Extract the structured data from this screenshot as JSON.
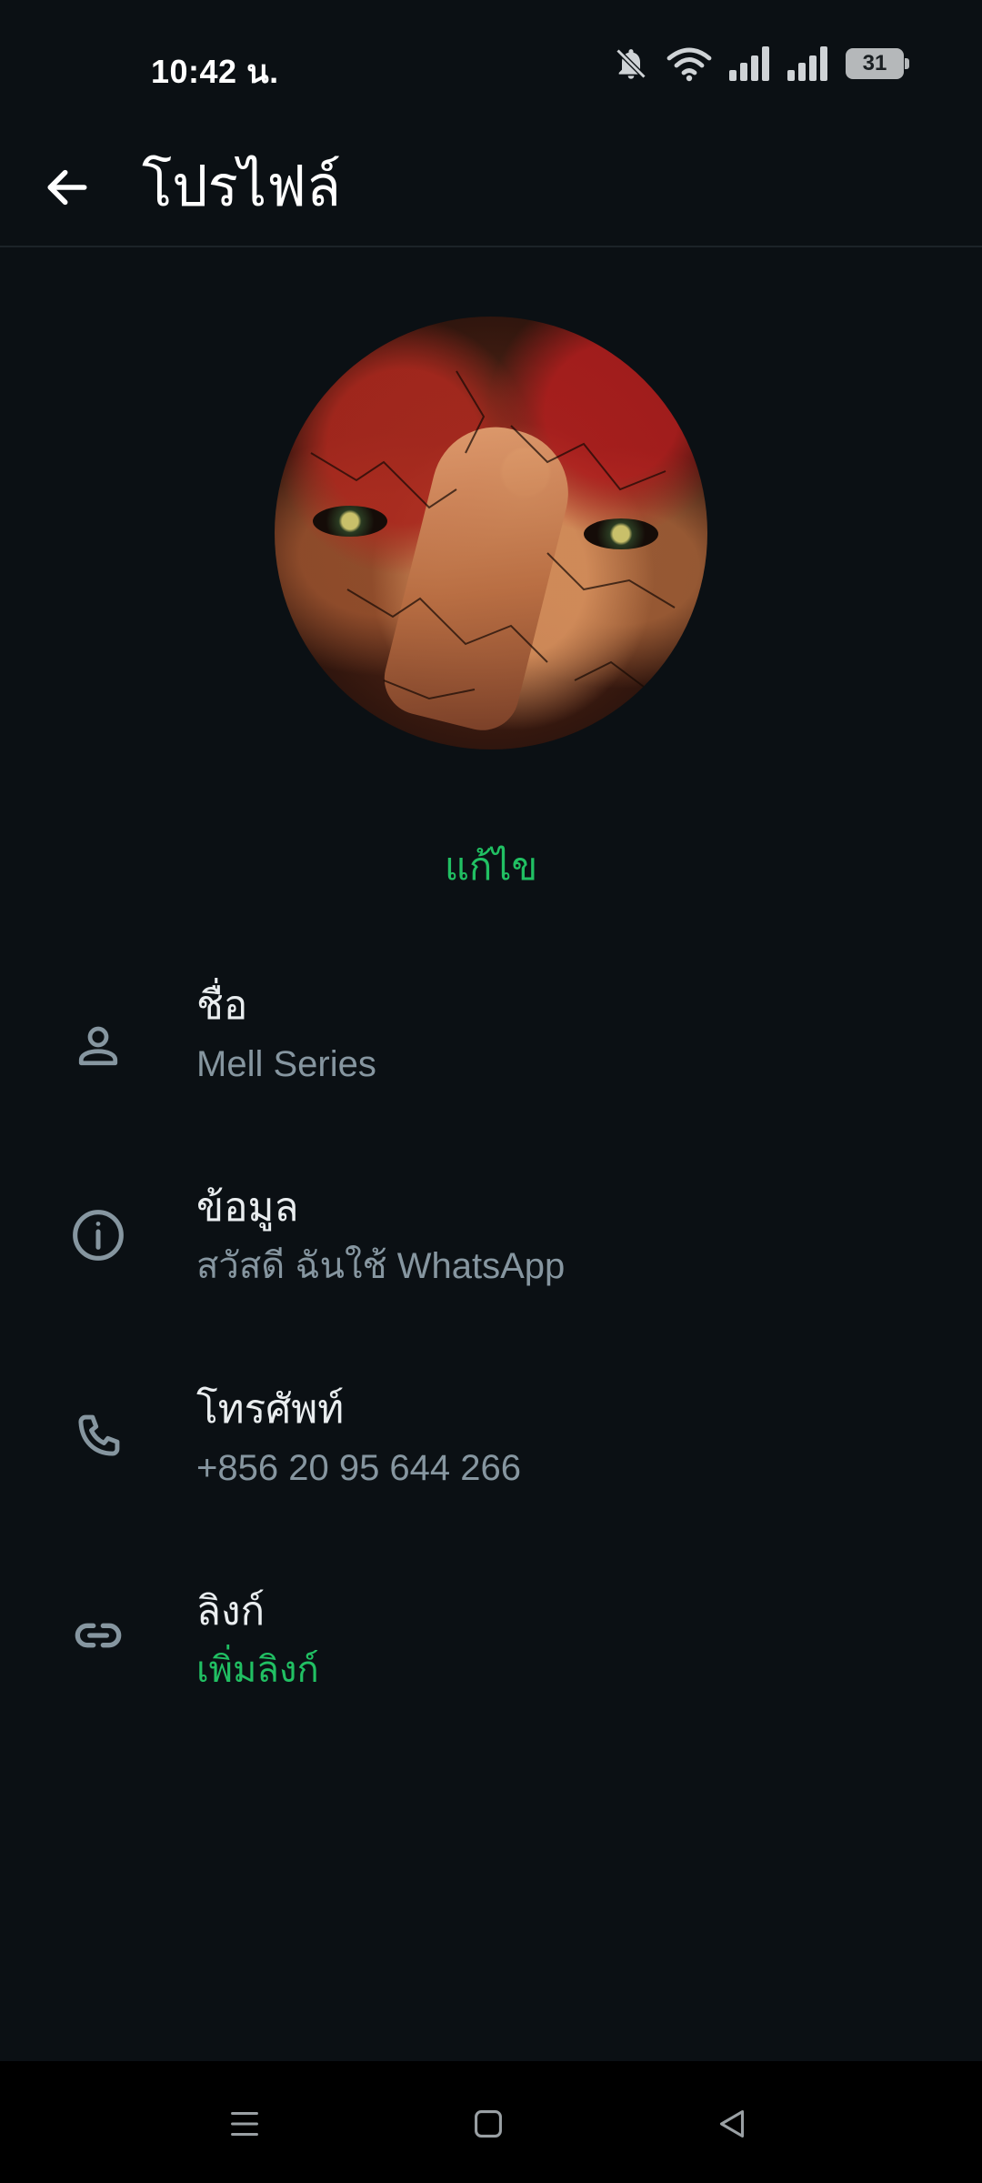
{
  "status_bar": {
    "time": "10:42 น.",
    "battery_level": "31",
    "icons": [
      "bell-muted-icon",
      "wifi-icon",
      "signal-icon",
      "signal-icon",
      "battery-icon"
    ]
  },
  "header": {
    "title": "โปรไฟล์",
    "back_icon": "arrow-left-icon"
  },
  "profile": {
    "edit_label": "แก้ไข"
  },
  "rows": {
    "name": {
      "label": "ชื่อ",
      "value": "Mell Series",
      "icon": "person-icon"
    },
    "about": {
      "label": "ข้อมูล",
      "value": "สวัสดี ฉันใช้ WhatsApp",
      "icon": "info-icon"
    },
    "phone": {
      "label": "โทรศัพท์",
      "value": "+856 20 95 644 266",
      "icon": "phone-icon"
    },
    "links": {
      "label": "ลิงก์",
      "value": "เพิ่มลิงก์",
      "icon": "link-icon"
    }
  },
  "nav": {
    "icons": [
      "menu-icon",
      "home-square-icon",
      "back-triangle-icon"
    ]
  },
  "colors": {
    "background": "#0b1014",
    "accent": "#21c063",
    "secondary_text": "#8696a0",
    "icon": "#8696a0"
  }
}
